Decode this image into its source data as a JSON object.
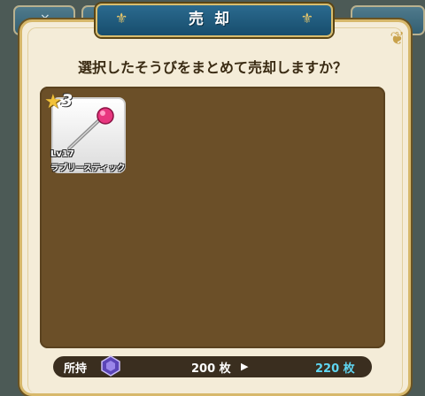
{
  "background_tabs": [
    {
      "icon": "close-icon",
      "glyph": "×"
    },
    {
      "icon": "tab-icon",
      "glyph": ""
    },
    {
      "icon": "tab-icon",
      "glyph": ""
    }
  ],
  "dialog": {
    "title": "売却",
    "question": "選択したそうびをまとめて売却しますか？"
  },
  "items": [
    {
      "rarity": "3",
      "level": "Lv17",
      "name": "ラブリースティック",
      "icon": "lovely-stick-wand-icon"
    }
  ],
  "currency": {
    "label": "所持",
    "icon": "purple-gem-icon",
    "before": "200",
    "before_unit": "枚",
    "after": "220",
    "after_unit": "枚",
    "accent": "#5fd6f2"
  }
}
